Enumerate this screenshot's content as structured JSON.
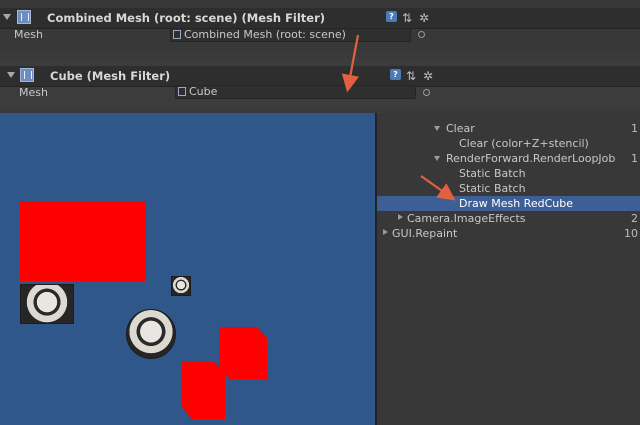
{
  "combined_panel": {
    "title": "Combined Mesh (root: scene) (Mesh Filter)",
    "mesh_label": "Mesh",
    "mesh_value": "Combined Mesh (root: scene)"
  },
  "cube_panel": {
    "title": "Cube (Mesh Filter)",
    "mesh_label": "Mesh",
    "mesh_value": "Cube"
  },
  "profiler": {
    "rows": [
      {
        "label": "Clear",
        "expanded": true,
        "number": "1"
      },
      {
        "label": "Clear (color+Z+stencil)",
        "number": ""
      },
      {
        "label": "RenderForward.RenderLoopJob",
        "expanded": true,
        "number": "1"
      },
      {
        "label": "Static Batch",
        "number": ""
      },
      {
        "label": "Static Batch",
        "number": ""
      },
      {
        "label": "Draw Mesh RedCube",
        "selected": true,
        "number": ""
      },
      {
        "label": "Camera.ImageEffects",
        "collapsed": true,
        "number": "2"
      },
      {
        "label": "GUI.Repaint",
        "collapsed": true,
        "number": "10"
      }
    ]
  },
  "colors": {
    "accent_arrow": "#e06040",
    "selection": "#3e5f96",
    "viewport_bg": "#2f5789",
    "red_cube": "#ff0000"
  }
}
